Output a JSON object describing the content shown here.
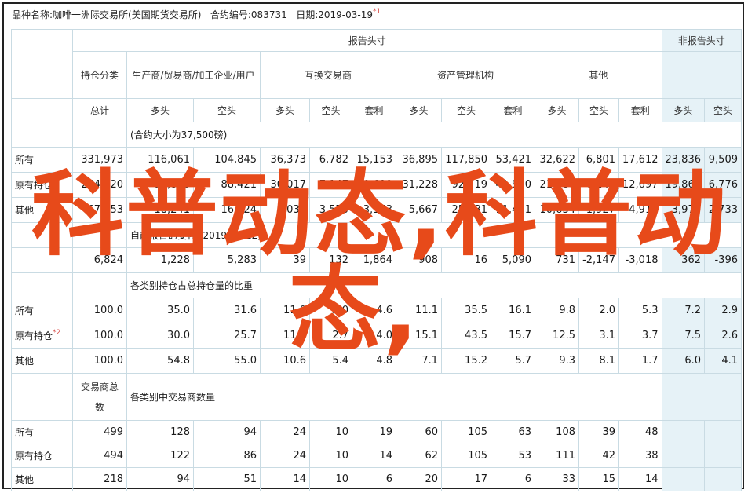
{
  "header": {
    "prefix": "品种名称:",
    "product": "咖啡一洲际交易所(美国期货交易所)",
    "code_label": "合约编号:",
    "code": "083731",
    "date_label": "日期:",
    "date": "2019-03-19",
    "footnote": "*1"
  },
  "groups": {
    "report": "报告头寸",
    "nonreport": "非报告头寸",
    "holding_class": "持仓分类",
    "producers": "生产商/贸易商/加工企业/用户",
    "swap": "互换交易商",
    "managed": "资产管理机构",
    "other": "其他",
    "total": "总计",
    "long": "多头",
    "short": "空头",
    "spread": "套利"
  },
  "sections": {
    "positions": "(合约大小为37,500磅)",
    "changes": "自前报告的变化 (2019-03-12)",
    "percent": "各类别持仓占总持仓量的比重",
    "traders_label_a": "交易商总",
    "traders_label_b": "数",
    "traders": "各类别中交易商数量"
  },
  "rows": {
    "all": "所有",
    "old": "原有持仓",
    "old_note": "*2",
    "other": "其他"
  },
  "positions": [
    [
      "331,973",
      "116,061",
      "104,845",
      "36,373",
      "6,782",
      "15,153",
      "36,895",
      "117,850",
      "53,421",
      "32,622",
      "6,801",
      "17,612",
      "23,836",
      "9,509"
    ],
    [
      "264,620",
      "97,820",
      "88,421",
      "30,017",
      "7,147",
      "10,619",
      "31,228",
      "92,719",
      "41,930",
      "21,988",
      "6,240",
      "12,697",
      "19,866",
      "6,776"
    ],
    [
      "67,353",
      "18,241",
      "16,424",
      "6,034",
      "3,570",
      "3,173",
      "5,667",
      "25,131",
      "11,491",
      "10,634",
      "1,927",
      "4,915",
      "3,970",
      "2,733"
    ]
  ],
  "changes": [
    "6,824",
    "1,228",
    "5,283",
    "39",
    "132",
    "1,864",
    "908",
    "16",
    "5,090",
    "731",
    "-2,147",
    "-3,018",
    "362",
    "-396"
  ],
  "percent": [
    [
      "100.0",
      "35.0",
      "31.6",
      "11.0",
      "2.0",
      "4.6",
      "11.1",
      "35.5",
      "16.1",
      "9.8",
      "2.0",
      "5.3",
      "7.2",
      "2.9"
    ],
    [
      "100.0",
      "30.0",
      "25.7",
      "11.3",
      "2.7",
      "4.0",
      "15.1",
      "43.5",
      "15.7",
      "12.5",
      "3.1",
      "3.7",
      "7.5",
      "2.6"
    ],
    [
      "100.0",
      "54.8",
      "55.0",
      "10.6",
      "5.4",
      "4.8",
      "7.1",
      "15.2",
      "5.7",
      "9.3",
      "8.1",
      "1.7",
      "6.0",
      "4.1"
    ]
  ],
  "traders": [
    [
      "499",
      "128",
      "94",
      "24",
      "10",
      "19",
      "60",
      "105",
      "63",
      "108",
      "39",
      "48"
    ],
    [
      "494",
      "122",
      "86",
      "24",
      "10",
      "14",
      "62",
      "105",
      "53",
      "111",
      "42",
      "38"
    ],
    [
      "218",
      "94",
      "51",
      "14",
      "10",
      "6",
      "20",
      "17",
      "6",
      "33",
      "15",
      "14"
    ]
  ],
  "watermark": {
    "line1": "科普动态,科普动",
    "line2": "态,"
  },
  "colors": {
    "border": "#c9dbe3",
    "nonreport_bg": "#e6f2f7",
    "watermark": "#e74a1a",
    "footnote": "#d9534f"
  }
}
